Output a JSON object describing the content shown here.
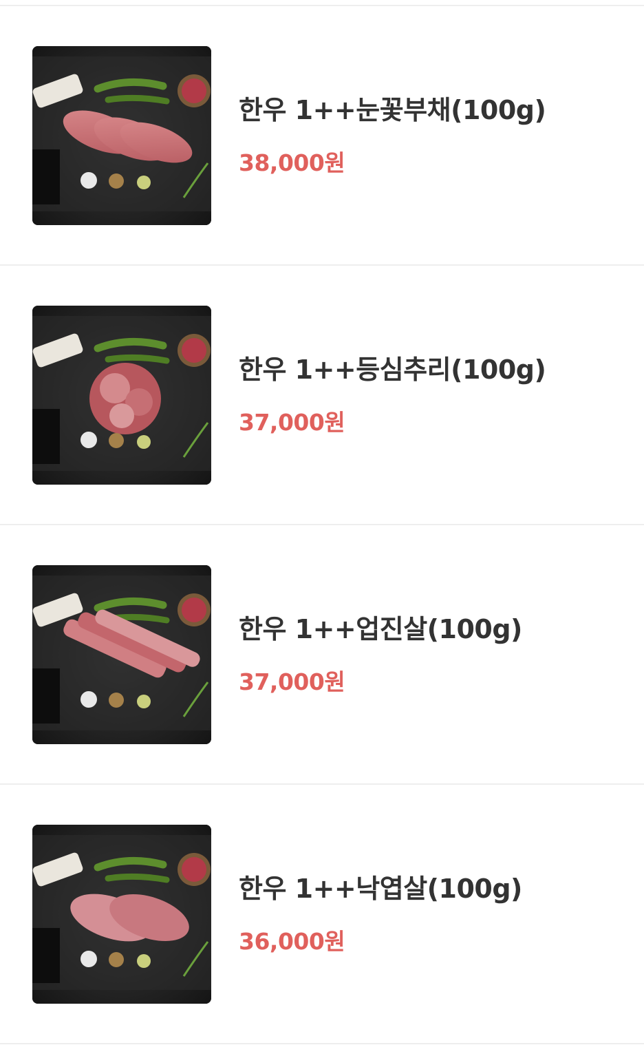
{
  "products": [
    {
      "name": "한우 1++눈꽃부채(100g)",
      "price": "38,000원",
      "image": "beef-platter-image"
    },
    {
      "name": "한우 1++등심추리(100g)",
      "price": "37,000원",
      "image": "beef-platter-image"
    },
    {
      "name": "한우 1++업진살(100g)",
      "price": "37,000원",
      "image": "beef-platter-image"
    },
    {
      "name": "한우 1++낙엽살(100g)",
      "price": "36,000원",
      "image": "beef-platter-image"
    }
  ],
  "colors": {
    "price": "#e0605c",
    "name": "#333333",
    "divider": "#eeeeee"
  }
}
